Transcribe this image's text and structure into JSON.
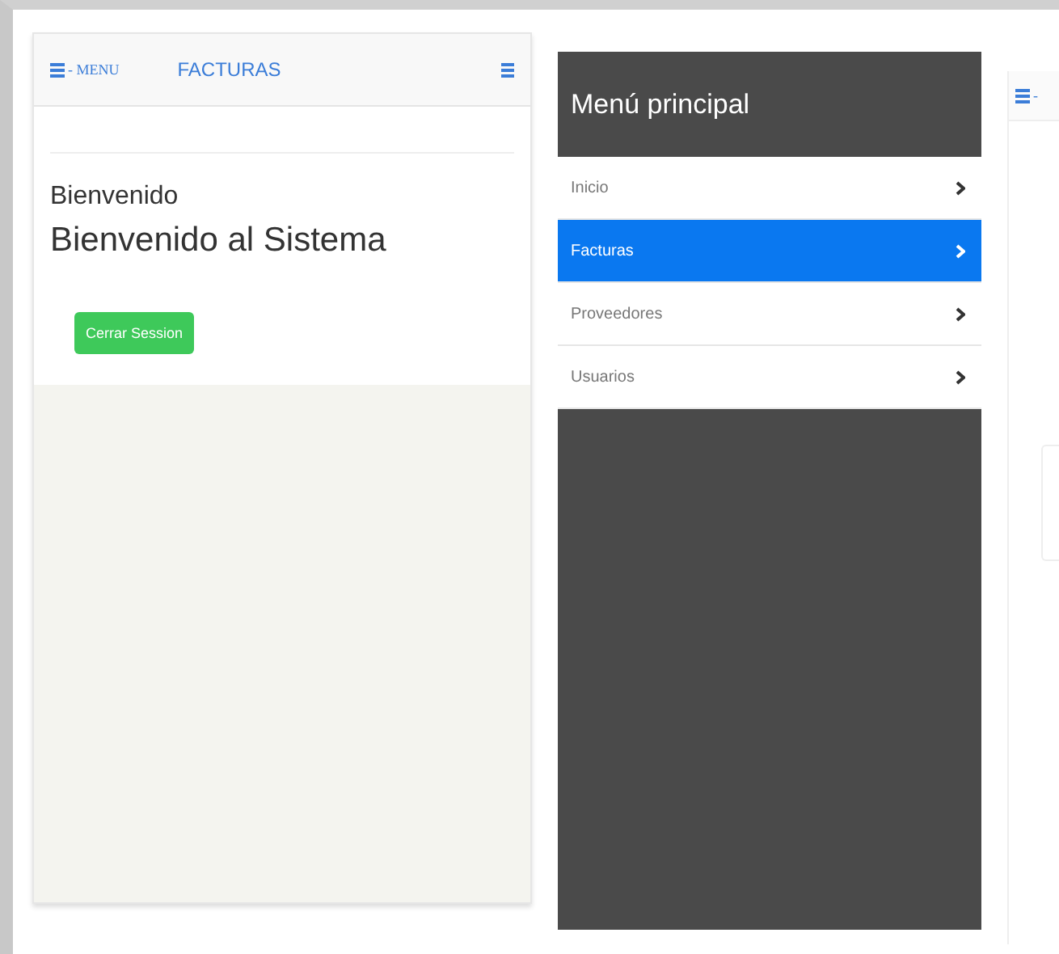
{
  "main_screen": {
    "header": {
      "menu_label": "- MENU",
      "title": "FACTURAS"
    },
    "heading": "Bienvenido",
    "subheading": "Bienvenido al Sistema",
    "logout_button": "Cerrar Session"
  },
  "side_menu": {
    "title": "Menú principal",
    "items": [
      {
        "label": "Inicio",
        "selected": false
      },
      {
        "label": "Facturas",
        "selected": true
      },
      {
        "label": "Proveedores",
        "selected": false
      },
      {
        "label": "Usuarios",
        "selected": false
      }
    ]
  },
  "partial_screen": {
    "menu_label": "-"
  }
}
